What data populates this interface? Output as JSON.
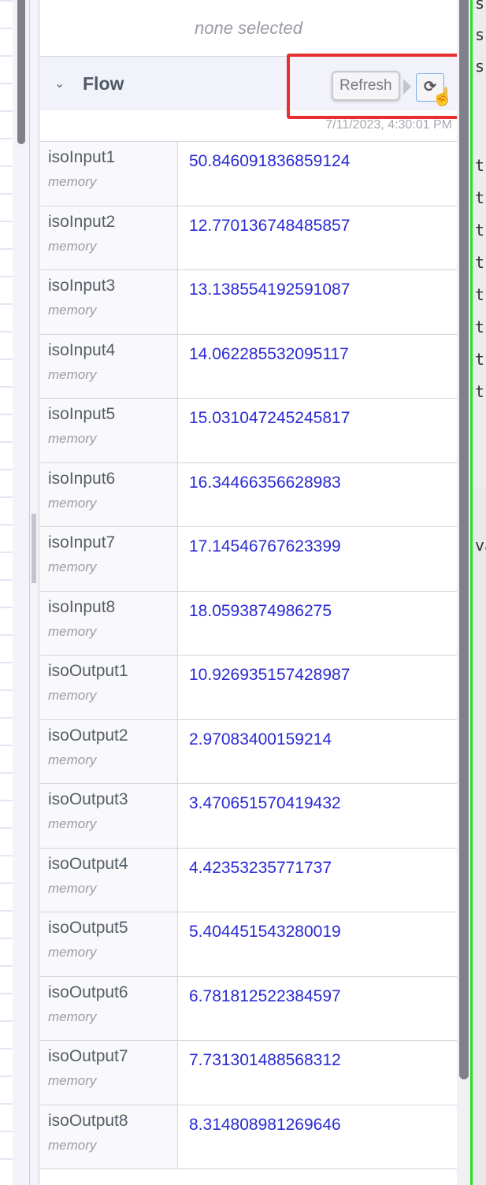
{
  "panel": {
    "none_selected": "none selected",
    "section_title": "Flow",
    "refresh_tooltip": "Refresh",
    "refresh_icon": "refresh-icon",
    "timestamp": "7/11/2023, 4:30:01 PM"
  },
  "rows": [
    {
      "key": "isoInput1",
      "type": "memory",
      "value": "50.846091836859124"
    },
    {
      "key": "isoInput2",
      "type": "memory",
      "value": "12.770136748485857"
    },
    {
      "key": "isoInput3",
      "type": "memory",
      "value": "13.138554192591087"
    },
    {
      "key": "isoInput4",
      "type": "memory",
      "value": "14.062285532095117"
    },
    {
      "key": "isoInput5",
      "type": "memory",
      "value": "15.031047245245817"
    },
    {
      "key": "isoInput6",
      "type": "memory",
      "value": "16.34466356628983"
    },
    {
      "key": "isoInput7",
      "type": "memory",
      "value": "17.14546767623399"
    },
    {
      "key": "isoInput8",
      "type": "memory",
      "value": "18.0593874986275"
    },
    {
      "key": "isoOutput1",
      "type": "memory",
      "value": "10.926935157428987"
    },
    {
      "key": "isoOutput2",
      "type": "memory",
      "value": "2.97083400159214"
    },
    {
      "key": "isoOutput3",
      "type": "memory",
      "value": "3.470651570419432"
    },
    {
      "key": "isoOutput4",
      "type": "memory",
      "value": "4.42353235771737"
    },
    {
      "key": "isoOutput5",
      "type": "memory",
      "value": "5.404451543280019"
    },
    {
      "key": "isoOutput6",
      "type": "memory",
      "value": "6.781812522384597"
    },
    {
      "key": "isoOutput7",
      "type": "memory",
      "value": "7.731301488568312"
    },
    {
      "key": "isoOutput8",
      "type": "memory",
      "value": "8.314808981269646"
    }
  ],
  "editor": {
    "lines": [
      "s",
      "s",
      "s",
      "t",
      "t",
      "t",
      "t",
      "t",
      "t",
      "t",
      "t",
      "va"
    ]
  },
  "colors": {
    "value": "#2a2ad6",
    "highlight": "#e63030",
    "divider": "#1ee61e"
  }
}
